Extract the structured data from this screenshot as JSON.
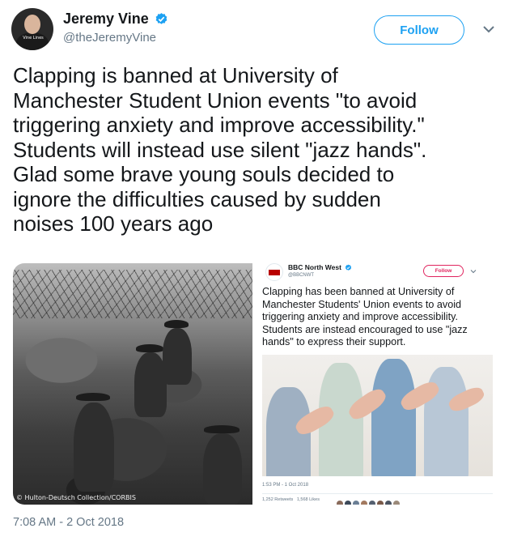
{
  "tweet": {
    "author_name": "Jeremy Vine",
    "author_handle": "@theJeremyVine",
    "avatar_caption": "Vine Lines",
    "follow_label": "Follow",
    "text": "Clapping is banned at University of\nManchester Student Union events \"to avoid\ntriggering anxiety and improve accessibility.\"\nStudents will instead use silent \"jazz hands\".\nGlad some brave young souls decided to\nignore the difficulties caused by sudden\nnoises 100 years ago",
    "timestamp": "7:08 AM - 2 Oct 2018",
    "accent_color": "#1da1f2",
    "verified_icon": "verified-badge-icon",
    "menu_icon": "chevron-down-icon"
  },
  "media": {
    "photo_credit": "© Hulton-Deutsch Collection/CORBIS",
    "quoted_tweet": {
      "author_name": "BBC North West",
      "author_handle": "@BBCNWT",
      "follow_label": "Follow",
      "text": "Clapping has been banned at University of\nManchester Students' Union events to avoid\ntriggering anxiety and improve accessibility.\nStudents are instead encouraged to use \"jazz\nhands\" to express their support.",
      "timestamp": "1:53 PM - 1 Oct 2018",
      "retweets": "1,252 Retweets",
      "likes": "1,568 Likes",
      "accent_color": "#e0245e",
      "logo_color": "#b80000"
    }
  }
}
